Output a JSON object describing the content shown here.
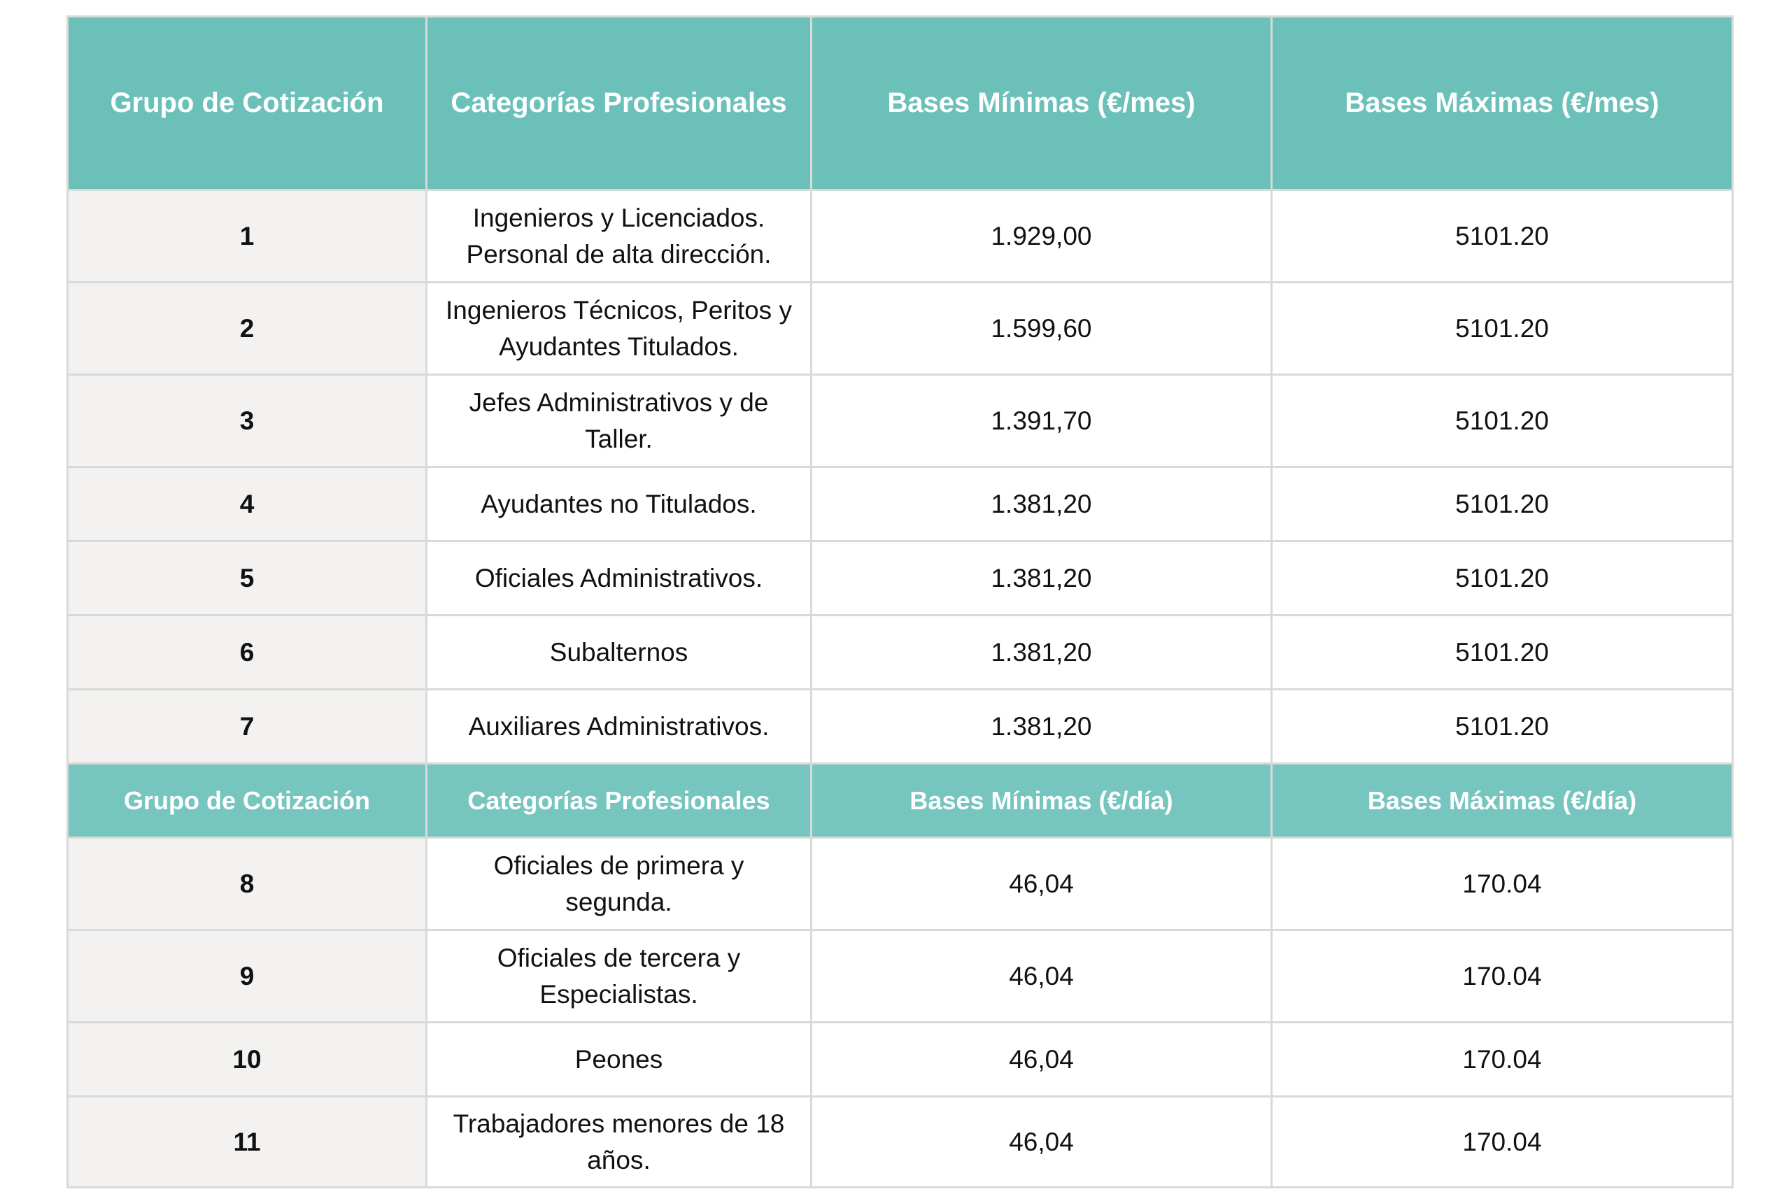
{
  "header_monthly": {
    "group": "Grupo de Cotización",
    "category": "Categorías Profesionales",
    "min": "Bases Mínimas (€/mes)",
    "max": "Bases Máximas (€/mes)"
  },
  "rows_monthly": [
    {
      "group": "1",
      "category": "Ingenieros y Licenciados. Personal de alta dirección.",
      "min": "1.929,00",
      "max": "5101.20"
    },
    {
      "group": "2",
      "category": "Ingenieros Técnicos, Peritos y Ayudantes Titulados.",
      "min": "1.599,60",
      "max": "5101.20"
    },
    {
      "group": "3",
      "category": "Jefes Administrativos y de Taller.",
      "min": "1.391,70",
      "max": "5101.20"
    },
    {
      "group": "4",
      "category": "Ayudantes no Titulados.",
      "min": "1.381,20",
      "max": "5101.20"
    },
    {
      "group": "5",
      "category": "Oficiales Administrativos.",
      "min": "1.381,20",
      "max": "5101.20"
    },
    {
      "group": "6",
      "category": "Subalternos",
      "min": "1.381,20",
      "max": "5101.20"
    },
    {
      "group": "7",
      "category": "Auxiliares Administrativos.",
      "min": "1.381,20",
      "max": "5101.20"
    }
  ],
  "header_daily": {
    "group": "Grupo de Cotización",
    "category": "Categorías Profesionales",
    "min": "Bases Mínimas (€/día)",
    "max": "Bases Máximas (€/día)"
  },
  "rows_daily": [
    {
      "group": "8",
      "category": "Oficiales de primera y segunda.",
      "min": "46,04",
      "max": "170.04"
    },
    {
      "group": "9",
      "category": "Oficiales de tercera y Especialistas.",
      "min": "46,04",
      "max": "170.04"
    },
    {
      "group": "10",
      "category": "Peones",
      "min": "46,04",
      "max": "170.04"
    },
    {
      "group": "11",
      "category": "Trabajadores menores de 18 años.",
      "min": "46,04",
      "max": "170.04"
    }
  ]
}
